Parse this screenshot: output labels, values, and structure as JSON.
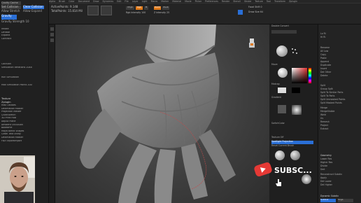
{
  "menubar": [
    "Alpha",
    "Brush",
    "Color",
    "Document",
    "Draw",
    "Dynamics",
    "Edit",
    "File",
    "Layer",
    "Light",
    "Macro",
    "Marker",
    "Material",
    "Movie",
    "Picker",
    "Preferences",
    "Render",
    "Stencil",
    "Stroke",
    "Texture",
    "Tool",
    "Transform",
    "Zplugin",
    "Zscript",
    "Help"
  ],
  "toolbar": {
    "draw_size_label": "Draw Size 64",
    "focal_shift_label": "Focal Shift 0",
    "mrgb": "Mrgb",
    "rgb": "Rgb",
    "m": "M",
    "zadd": "Zadd",
    "zsub": "Zsub",
    "rgb_intensity": "Rgb Intensity 100",
    "z_intensity": "Z Intensity 25",
    "active_points": "ActivePoints: 9.148",
    "total_points": "TotalPoints: 15.814 Mil"
  },
  "left_panel": {
    "top_items": [
      "Cavity Cache",
      "Set Collision",
      "Clear Collision",
      "Allow Stretch",
      "Allow Expand",
      "Gravity",
      "Gravity Strength 10",
      "Inflate",
      "Deflate",
      "Expand",
      "Contract",
      "Collision",
      "Simulation Iterations 2048",
      "Run Simulation",
      "Max Simulation Points 200"
    ],
    "texture_header": "Texture",
    "zplugin_header": "Zplugin",
    "plugins": [
      "Misc Utilities",
      "Decimation Master",
      "Projection Master",
      "QuickSketch",
      "3D Print Hub",
      "Adjust Plane",
      "Ambient Occlusion",
      "BoxedPre",
      "Maya Blend Shapes",
      "Clean Text Utility",
      "Decimation Master",
      "FBX ExportImport",
      "Intersection Masker",
      "Multi Map Exporter"
    ]
  },
  "right_panel": {
    "quick_tab": "Double Convert",
    "polish_buttons": [
      "Polish",
      "Polish By Features"
    ],
    "col1_labels": [
      "Move",
      "Matcap",
      "MatcapGray",
      "SkinShade",
      "Gradient",
      "SwitchColor",
      "Alternate",
      "Texture Off",
      "Mrgb",
      "Spotlight Projection",
      "Reset Current Brush",
      "Alpha Off",
      "Texture Off"
    ],
    "col2_labels": [
      "Lo Ri",
      "Hi Ri",
      "Rename",
      "AutoReorder",
      "All Low",
      "All High",
      "Copy",
      "Paste",
      "Append",
      "Duplicate",
      "Insert",
      "Del Other",
      "Delete",
      "Split",
      "Group Split",
      "Split To Similar Parts",
      "Split To Parts",
      "Split Unmasked Points",
      "Split Masked Points",
      "Merge",
      "MergeVisible",
      "Weld",
      "Uv",
      "Remesh",
      "Project",
      "Extract",
      "Geometry",
      "Lower Res",
      "Higher Res",
      "Divide",
      "Smt",
      "Suv",
      "Reconstruct Subdiv",
      "Apply",
      "Del Lower",
      "Del Higher",
      "Dynamic Subdiv"
    ],
    "mode_buttons": [
      "Subtool",
      "Mrgb"
    ]
  },
  "subscribe": {
    "text": "SUBSC..."
  },
  "colors": {
    "accent_orange": "#e07a1a",
    "accent_blue": "#2a6fd6",
    "subscribe_red": "#e53935"
  }
}
